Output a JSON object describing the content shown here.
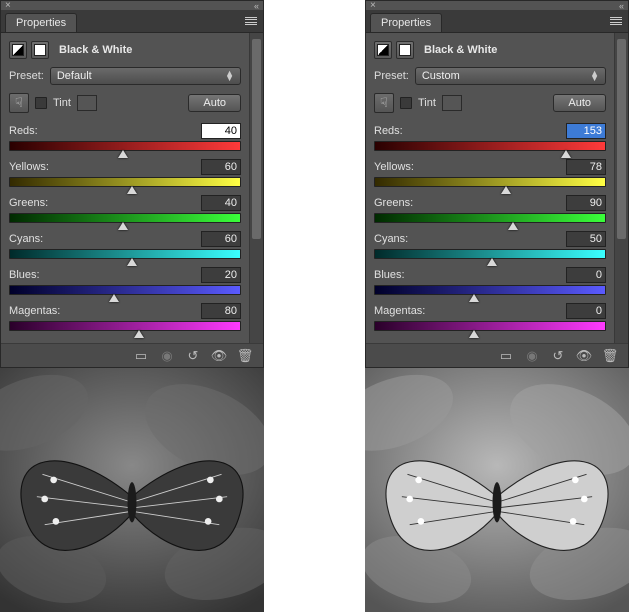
{
  "panels": [
    {
      "tab": "Properties",
      "adjustmentTitle": "Black & White",
      "presetLabel": "Preset:",
      "presetValue": "Default",
      "tintLabel": "Tint",
      "autoLabel": "Auto",
      "sliders": {
        "reds": {
          "label": "Reds:",
          "value": "40",
          "pos": 49,
          "valueState": "editing"
        },
        "yellows": {
          "label": "Yellows:",
          "value": "60",
          "pos": 53,
          "valueState": "normal"
        },
        "greens": {
          "label": "Greens:",
          "value": "40",
          "pos": 49,
          "valueState": "normal"
        },
        "cyans": {
          "label": "Cyans:",
          "value": "60",
          "pos": 53,
          "valueState": "normal"
        },
        "blues": {
          "label": "Blues:",
          "value": "20",
          "pos": 45,
          "valueState": "normal"
        },
        "magentas": {
          "label": "Magentas:",
          "value": "80",
          "pos": 56,
          "valueState": "normal"
        }
      }
    },
    {
      "tab": "Properties",
      "adjustmentTitle": "Black & White",
      "presetLabel": "Preset:",
      "presetValue": "Custom",
      "tintLabel": "Tint",
      "autoLabel": "Auto",
      "sliders": {
        "reds": {
          "label": "Reds:",
          "value": "153",
          "pos": 83,
          "valueState": "selected"
        },
        "yellows": {
          "label": "Yellows:",
          "value": "78",
          "pos": 57,
          "valueState": "normal"
        },
        "greens": {
          "label": "Greens:",
          "value": "90",
          "pos": 60,
          "valueState": "normal"
        },
        "cyans": {
          "label": "Cyans:",
          "value": "50",
          "pos": 51,
          "valueState": "normal"
        },
        "blues": {
          "label": "Blues:",
          "value": "0",
          "pos": 43,
          "valueState": "normal"
        },
        "magentas": {
          "label": "Magentas:",
          "value": "0",
          "pos": 43,
          "valueState": "normal"
        }
      }
    }
  ]
}
